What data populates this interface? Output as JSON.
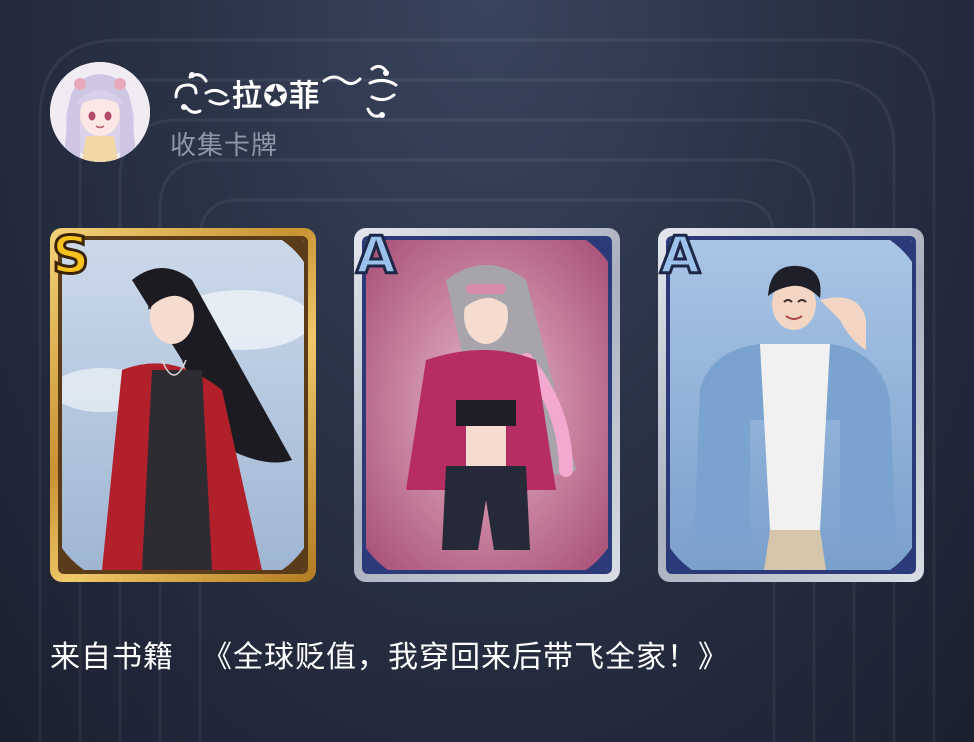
{
  "profile": {
    "username": "拉✪菲",
    "subtitle": "收集卡牌",
    "avatar_icon": "avatar-girl-icon"
  },
  "cards": [
    {
      "rank": "S",
      "frame": "gold",
      "character": "long-black-hair-woman-red-coat",
      "colors": {
        "bg": "#b8cbe0",
        "coat": "#b2212b"
      }
    },
    {
      "rank": "A",
      "frame": "silver",
      "character": "silver-hair-woman-pink-jacket",
      "colors": {
        "bg": "#c77a98",
        "coat": "#b52d63"
      }
    },
    {
      "rank": "A",
      "frame": "silver",
      "character": "black-hair-man-blue-jacket",
      "colors": {
        "bg": "#8fb2db",
        "coat": "#7ba3cf"
      }
    }
  ],
  "source": {
    "label": "来自书籍",
    "book_title": "《全球贬值，我穿回来后带飞全家！》"
  },
  "colors": {
    "background": "#2a3246",
    "text": "#ffffff",
    "subtitle": "#8f97a8",
    "s_rank": "#f8c21c",
    "a_rank": "#9cc1ea"
  }
}
